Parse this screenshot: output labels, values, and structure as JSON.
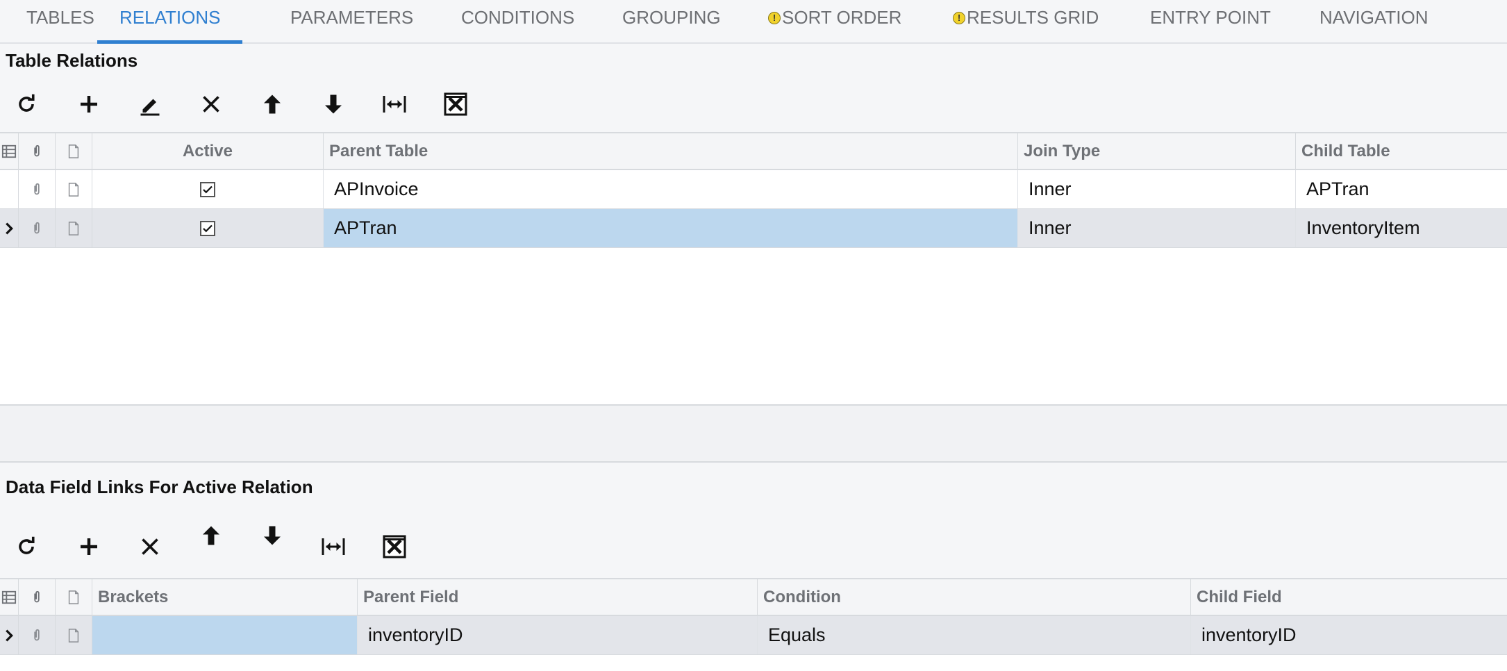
{
  "tabs": [
    {
      "label": "TABLES",
      "warning": false
    },
    {
      "label": "RELATIONS",
      "warning": false,
      "active": true
    },
    {
      "label": "PARAMETERS",
      "warning": false
    },
    {
      "label": "CONDITIONS",
      "warning": false
    },
    {
      "label": "GROUPING",
      "warning": false
    },
    {
      "label": "SORT ORDER",
      "warning": true
    },
    {
      "label": "RESULTS GRID",
      "warning": true
    },
    {
      "label": "ENTRY POINT",
      "warning": false
    },
    {
      "label": "NAVIGATION",
      "warning": false
    }
  ],
  "relations": {
    "title": "Table Relations",
    "columns": {
      "active": "Active",
      "parent_table": "Parent Table",
      "join_type": "Join Type",
      "child_table": "Child Table"
    },
    "rows": [
      {
        "active": true,
        "parent_table": "APInvoice",
        "join_type": "Inner",
        "child_table": "APTran",
        "selected": false
      },
      {
        "active": true,
        "parent_table": "APTran",
        "join_type": "Inner",
        "child_table": "InventoryItem",
        "selected": true
      }
    ]
  },
  "links": {
    "title": "Data Field Links For Active Relation",
    "columns": {
      "brackets": "Brackets",
      "parent_field": "Parent Field",
      "condition": "Condition",
      "child_field": "Child Field"
    },
    "rows": [
      {
        "brackets": "",
        "parent_field": "inventoryID",
        "condition": "Equals",
        "child_field": "inventoryID",
        "selected": true
      }
    ]
  },
  "icons": {
    "toolbar_relations": [
      "refresh-icon",
      "add-icon",
      "edit-icon",
      "delete-icon",
      "move-up-icon",
      "move-down-icon",
      "fit-columns-icon",
      "export-excel-icon"
    ],
    "toolbar_links": [
      "refresh-icon",
      "add-icon",
      "delete-icon",
      "move-up-icon",
      "move-down-icon",
      "fit-columns-icon",
      "export-excel-icon"
    ]
  },
  "colors": {
    "accent": "#2f7fd0",
    "selected_cell": "#bcd7ee",
    "selected_row": "#e3e5ea",
    "warning": "#f1d22c"
  }
}
